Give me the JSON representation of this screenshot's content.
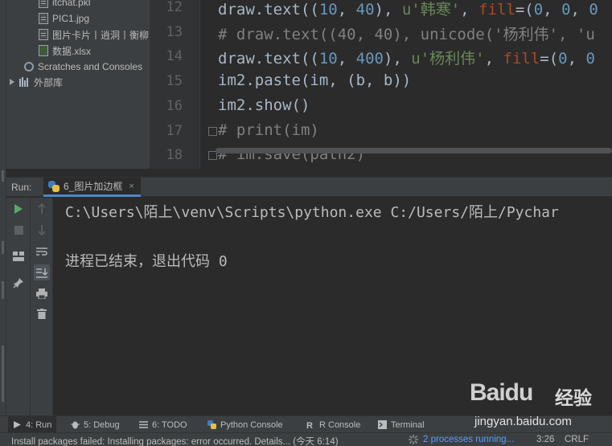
{
  "project_tree": {
    "items": [
      {
        "label": "itchat.pkl",
        "icon": "file-icon"
      },
      {
        "label": "PIC1.jpg",
        "icon": "image-file-icon"
      },
      {
        "label": "图片卡片丨逍洞丨衡柳",
        "icon": "file-icon"
      },
      {
        "label": "数据.xlsx",
        "icon": "excel-file-icon"
      },
      {
        "label": "Scratches and Consoles",
        "icon": "scratches-icon"
      },
      {
        "label": "外部库",
        "icon": "library-icon"
      }
    ]
  },
  "editor": {
    "line_numbers": [
      "12",
      "13",
      "14",
      "15",
      "16",
      "17",
      "18"
    ],
    "lines": [
      [
        {
          "t": "draw.text(("
        },
        {
          "t": "10",
          "c": "num"
        },
        {
          "t": ", "
        },
        {
          "t": "40",
          "c": "num"
        },
        {
          "t": "), "
        },
        {
          "t": "u'韩寒'",
          "c": "str"
        },
        {
          "t": ", "
        },
        {
          "t": "fill",
          "c": "kw"
        },
        {
          "t": "=("
        },
        {
          "t": "0",
          "c": "num"
        },
        {
          "t": ", "
        },
        {
          "t": "0",
          "c": "num"
        },
        {
          "t": ", "
        },
        {
          "t": "0",
          "c": "num"
        }
      ],
      [
        {
          "t": "# draw.text((40, 40), unicode('杨利伟', 'u",
          "c": "cmt"
        }
      ],
      [
        {
          "t": "draw.text(("
        },
        {
          "t": "10",
          "c": "num"
        },
        {
          "t": ", "
        },
        {
          "t": "400",
          "c": "num"
        },
        {
          "t": "), "
        },
        {
          "t": "u'杨利伟'",
          "c": "str"
        },
        {
          "t": ", "
        },
        {
          "t": "fill",
          "c": "kw"
        },
        {
          "t": "=("
        },
        {
          "t": "0",
          "c": "num"
        },
        {
          "t": ", "
        },
        {
          "t": "0",
          "c": "num"
        }
      ],
      [
        {
          "t": "im2.paste(im, (b, b))"
        }
      ],
      [
        {
          "t": "im2.show()"
        }
      ],
      [
        {
          "t": "# print(im)",
          "c": "cmt"
        }
      ],
      [
        {
          "t": "# im.save(path2)",
          "c": "cmt"
        }
      ]
    ]
  },
  "run_panel": {
    "label": "Run:",
    "tab_label": "6_图片加边框",
    "tab_close": "×",
    "console_lines": [
      "C:\\Users\\陌上\\venv\\Scripts\\python.exe C:/Users/陌上/Pychar",
      "进程已结束，退出代码 0"
    ]
  },
  "tool_windows": [
    {
      "label": "4: Run",
      "icon": "run-icon",
      "active": true
    },
    {
      "label": "5: Debug",
      "icon": "debug-icon"
    },
    {
      "label": "6: TODO",
      "icon": "todo-icon"
    },
    {
      "label": "Python Console",
      "icon": "python-console-icon"
    },
    {
      "label": "R Console",
      "icon": "r-console-icon"
    },
    {
      "label": "Terminal",
      "icon": "terminal-icon"
    }
  ],
  "status_bar": {
    "message": "Install packages failed: Installing packages: error occurred. Details... (今天 6:14)",
    "processes": "2 processes running...",
    "position": "3:26",
    "line_separator": "CRLF"
  },
  "watermark": {
    "logo": "Baidu",
    "cn": "经验",
    "url": "jingyan.baidu.com"
  },
  "colors": {
    "accent": "#4a88c7",
    "run_green": "#59a869",
    "number": "#6897bb",
    "string": "#6a8759",
    "keyword_arg": "#aa4926",
    "comment": "#808080"
  }
}
